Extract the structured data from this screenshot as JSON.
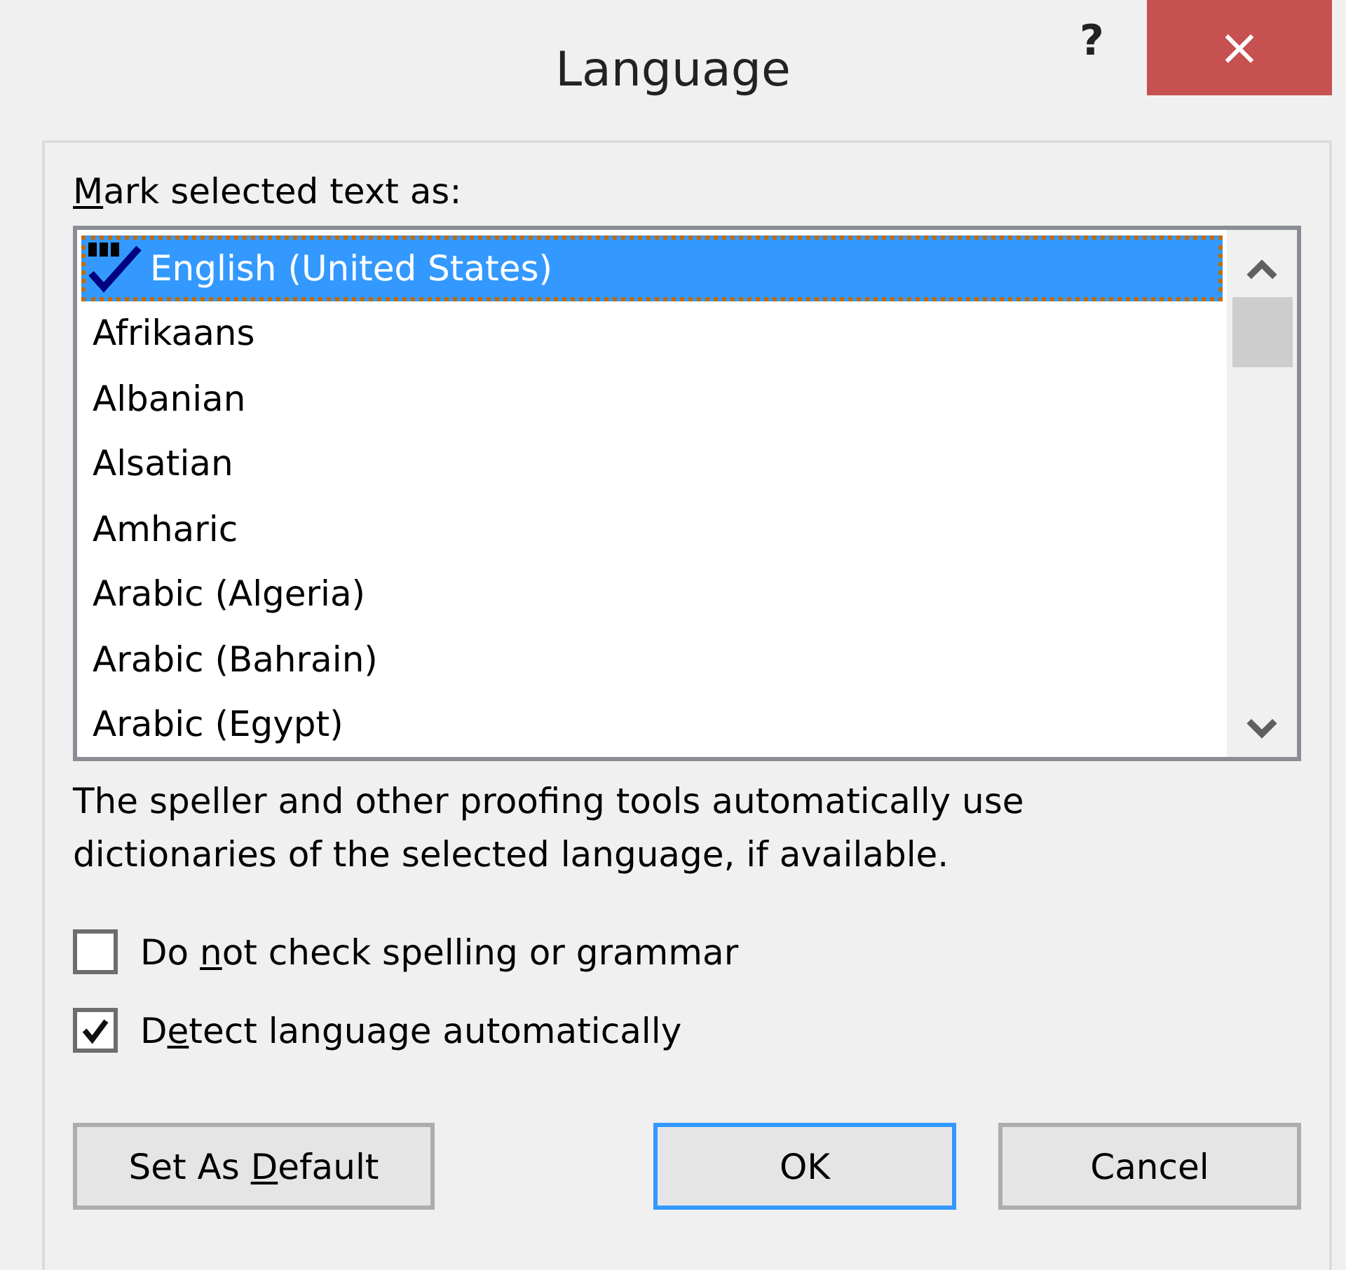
{
  "window": {
    "title": "Language",
    "help_button": "?",
    "close_button": "×"
  },
  "list_label": [
    {
      "text": "M",
      "access_key": true
    },
    {
      "text": "ark selected text as:",
      "access_key": false
    }
  ],
  "languages": [
    {
      "name": "English (United States)",
      "selected": true,
      "proofing_icon": true
    },
    {
      "name": "Afrikaans",
      "selected": false,
      "proofing_icon": false
    },
    {
      "name": "Albanian",
      "selected": false,
      "proofing_icon": false
    },
    {
      "name": "Alsatian",
      "selected": false,
      "proofing_icon": false
    },
    {
      "name": "Amharic",
      "selected": false,
      "proofing_icon": false
    },
    {
      "name": "Arabic (Algeria)",
      "selected": false,
      "proofing_icon": false
    },
    {
      "name": "Arabic (Bahrain)",
      "selected": false,
      "proofing_icon": false
    },
    {
      "name": "Arabic (Egypt)",
      "selected": false,
      "proofing_icon": false
    }
  ],
  "description": "The speller and other proofing tools automatically use dictionaries of the selected language, if available.",
  "options": [
    {
      "label": [
        {
          "text": "Do ",
          "access_key": false
        },
        {
          "text": "n",
          "access_key": true
        },
        {
          "text": "ot check spelling or grammar",
          "access_key": false
        }
      ],
      "checked": false
    },
    {
      "label": [
        {
          "text": "D",
          "access_key": false
        },
        {
          "text": "e",
          "access_key": true
        },
        {
          "text": "tect language automatically",
          "access_key": false
        }
      ],
      "checked": true
    }
  ],
  "buttons": [
    {
      "label": [
        {
          "text": "Set As ",
          "access_key": false
        },
        {
          "text": "D",
          "access_key": true
        },
        {
          "text": "efault",
          "access_key": false
        }
      ],
      "default": false
    },
    {
      "label": [
        {
          "text": "OK",
          "access_key": false
        }
      ],
      "default": true
    },
    {
      "label": [
        {
          "text": "Cancel",
          "access_key": false
        }
      ],
      "default": false
    }
  ]
}
